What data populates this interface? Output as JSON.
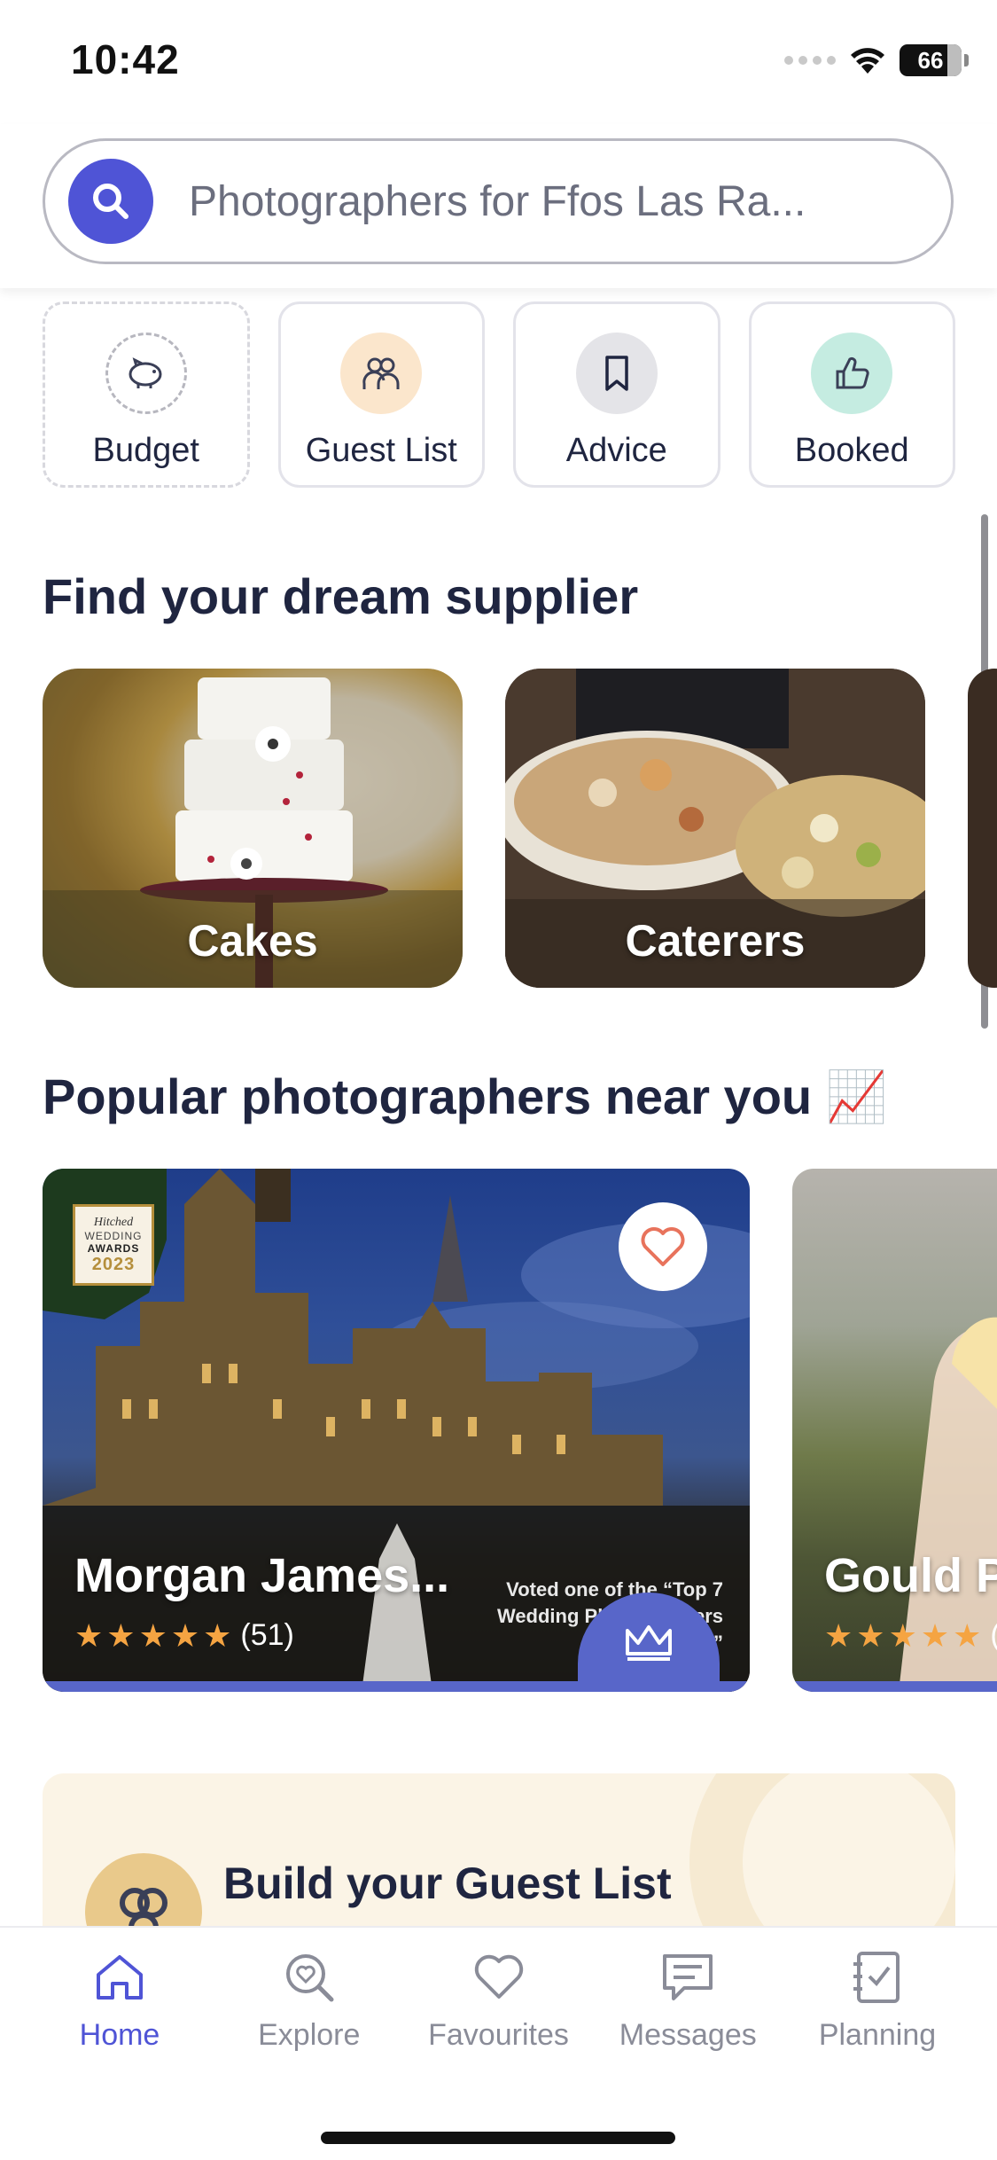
{
  "status_bar": {
    "time": "10:42",
    "battery": "66"
  },
  "search": {
    "placeholder": "Photographers for Ffos Las Ra..."
  },
  "quick_actions": [
    {
      "label": "Budget",
      "icon": "piggy-bank-icon"
    },
    {
      "label": "Guest List",
      "icon": "people-icon"
    },
    {
      "label": "Advice",
      "icon": "bookmark-icon"
    },
    {
      "label": "Booked",
      "icon": "thumbs-up-icon"
    }
  ],
  "suppliers": {
    "title": "Find your dream supplier",
    "items": [
      {
        "label": "Cakes"
      },
      {
        "label": "Caterers"
      }
    ]
  },
  "photographers": {
    "title": "Popular photographers near you 📈",
    "award": {
      "line1": "Hitched",
      "line2": "WEDDING",
      "line3": "AWARDS",
      "year": "2023"
    },
    "items": [
      {
        "name": "Morgan James...",
        "rating_count": "(51)",
        "badge": "Voted one of the “Top 7 Wedding Photographers in Wales”"
      },
      {
        "name": "Gould P",
        "rating_count": "("
      }
    ]
  },
  "guest_banner": {
    "title": "Build your Guest List"
  },
  "nav": [
    {
      "label": "Home",
      "icon": "home-icon",
      "active": true
    },
    {
      "label": "Explore",
      "icon": "explore-icon",
      "active": false
    },
    {
      "label": "Favourites",
      "icon": "heart-icon",
      "active": false
    },
    {
      "label": "Messages",
      "icon": "messages-icon",
      "active": false
    },
    {
      "label": "Planning",
      "icon": "planning-icon",
      "active": false
    }
  ],
  "colors": {
    "accent": "#4f54d6",
    "star": "#f5a442",
    "card_bar": "#5866c9"
  }
}
